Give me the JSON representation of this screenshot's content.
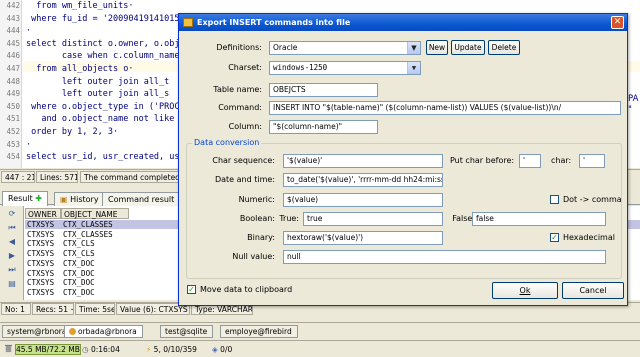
{
  "editor": {
    "lines": [
      {
        "n": "442",
        "text": "  from wm_file_units·"
      },
      {
        "n": "443",
        "text": " where fu_id = '20090419141015"
      },
      {
        "n": "444",
        "text": "·"
      },
      {
        "n": "445",
        "text": "select distinct o.owner, o.obj"
      },
      {
        "n": "446",
        "text": "       case when c.column_name"
      },
      {
        "n": "447",
        "text": "  from all_objects o·"
      },
      {
        "n": "448",
        "text": "       left outer join all_t"
      },
      {
        "n": "449",
        "text": "       left outer join all_s"
      },
      {
        "n": "450",
        "text": " where o.object_type in ('PROC"
      },
      {
        "n": "451",
        "text": "   and o.object_name not like"
      },
      {
        "n": "452",
        "text": " order by 1, 2, 3·"
      },
      {
        "n": "453",
        "text": "·"
      },
      {
        "n": "454",
        "text": "select usr_id, usr_created, usr"
      }
    ],
    "right_fragment_1": "PA",
    "right_fragment_2": "\""
  },
  "editor_status": {
    "position": "447 : 21",
    "lines": "Lines: 571",
    "message": "The command completed s"
  },
  "result_tabs": [
    "Result",
    "History",
    "Command result"
  ],
  "grid": {
    "columns": [
      "OWNER",
      "OBJECT_NAME"
    ],
    "rows": [
      [
        "CTXSYS",
        "CTX_CLASSES"
      ],
      [
        "CTXSYS",
        "CTX_CLASSES"
      ],
      [
        "CTXSYS",
        "CTX_CLS"
      ],
      [
        "CTXSYS",
        "CTX_CLS"
      ],
      [
        "CTXSYS",
        "CTX_DOC"
      ],
      [
        "CTXSYS",
        "CTX_DOC"
      ],
      [
        "CTXSYS",
        "CTX_DOC"
      ],
      [
        "CTXSYS",
        "CTX_DOC"
      ]
    ],
    "selected_row": 0
  },
  "result_status": {
    "no": "No: 1",
    "recs": "Recs: 51 +",
    "time": "Time: 5sec",
    "value": "Value (6): CTXSYS",
    "type": "Type: VARCHAR2"
  },
  "sessions": [
    "system@rbnora",
    "orbada@rbnora",
    "test@sqlite",
    "employe@firebird"
  ],
  "active_session": 1,
  "statusbar": {
    "memory": "45.5 MB/72.2 MB",
    "clock": "0:16:04",
    "counter": "5, 0/10/359",
    "extra": "0/0"
  },
  "dialog": {
    "title": "Export INSERT commands into file",
    "definitions_label": "Definitions:",
    "definitions_value": "Oracle",
    "btn_new": "New",
    "btn_update": "Update",
    "btn_delete": "Delete",
    "charset_label": "Charset:",
    "charset_value": "windows-1250",
    "table_label": "Table name:",
    "table_value": "OBEJCTS",
    "command_label": "Command:",
    "command_value": "INSERT INTO \"$(table-name)\" ($(column-name-list)) VALUES ($(value-list))\\n/",
    "column_label": "Column:",
    "column_value": "\"$(column-name)\"",
    "group_title": "Data conversion",
    "charseq_label": "Char sequence:",
    "charseq_value": "'$(value)'",
    "putchar_label": "Put char before:",
    "putchar_value": "'",
    "char_label": "char:",
    "char_value": "'",
    "datetime_label": "Date and time:",
    "datetime_value": "to_date('$(value)', 'rrrr-mm-dd hh24:mi:ss')",
    "numeric_label": "Numeric:",
    "numeric_value": "$(value)",
    "dot_label": "Dot -> comma",
    "dot_checked": false,
    "boolean_label": "Boolean:",
    "true_label": "True:",
    "true_value": "true",
    "false_label": "False:",
    "false_value": "false",
    "binary_label": "Binary:",
    "binary_value": "hextoraw('$(value)')",
    "hex_label": "Hexadecimal",
    "hex_checked": true,
    "null_label": "Null value:",
    "null_value": "null",
    "clipboard_label": "Move data to clipboard",
    "clipboard_checked": true,
    "ok_label": "Ok",
    "cancel_label": "Cancel"
  }
}
